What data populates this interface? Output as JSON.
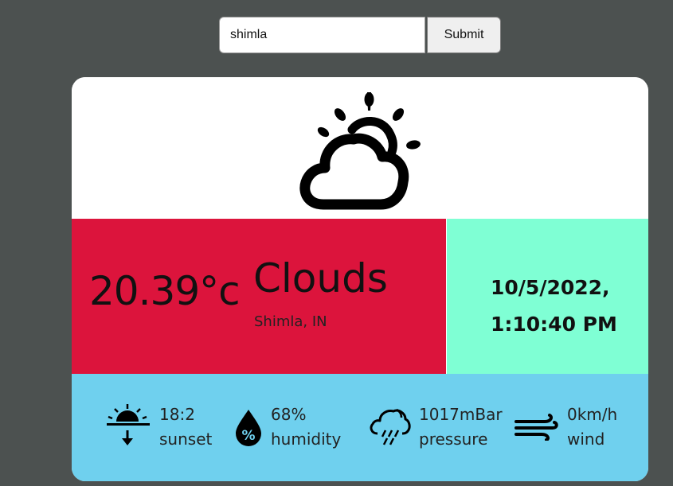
{
  "search": {
    "value": "shimla",
    "submit_label": "Submit"
  },
  "weather": {
    "icon": "cloudy-sun-icon",
    "temperature": "20.39°c",
    "condition": "Clouds",
    "location": "Shimla, IN",
    "date": "10/5/2022,",
    "time": "1:10:40 PM"
  },
  "stats": {
    "sunset": {
      "value": "18:2",
      "label": "sunset",
      "icon": "sunset-icon"
    },
    "humidity": {
      "value": "68%",
      "label": "humidity",
      "icon": "humidity-drop-icon"
    },
    "pressure": {
      "value": "1017mBar",
      "label": "pressure",
      "icon": "rain-cloud-icon"
    },
    "wind": {
      "value": "0km/h",
      "label": "wind",
      "icon": "wind-icon"
    }
  },
  "colors": {
    "background": "#4c5150",
    "temperature_panel": "#dc143c",
    "time_panel": "#7fffd4",
    "stats_panel": "#6fd0ee"
  }
}
